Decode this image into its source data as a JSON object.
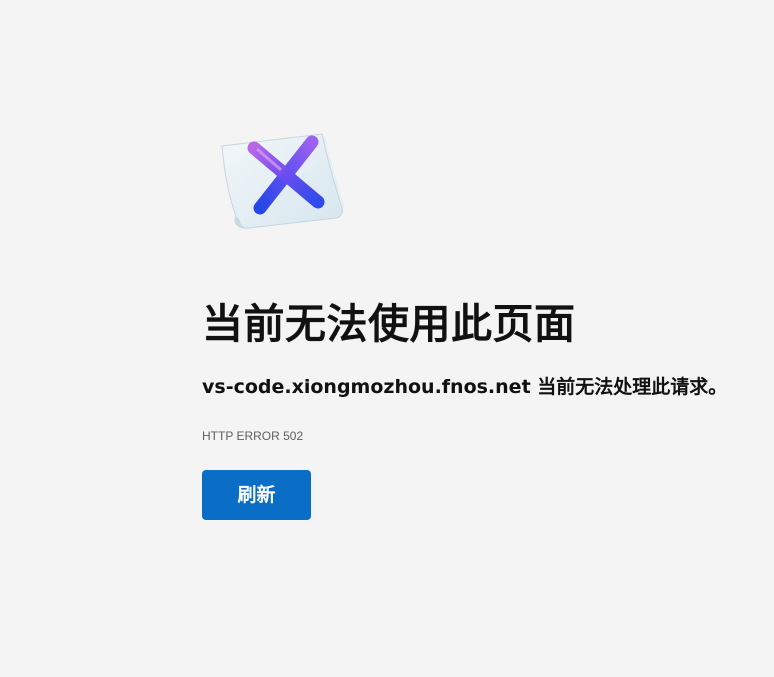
{
  "page": {
    "title": "当前无法使用此页面",
    "message": "vs-code.xiongmozhou.fnos.net 当前无法处理此请求。",
    "error_code": "HTTP ERROR 502",
    "refresh_label": "刷新"
  },
  "colors": {
    "background": "#f4f4f4",
    "button": "#0a6dc6",
    "button_text": "#ffffff",
    "error_code_text": "#5f5f5f"
  },
  "icons": {
    "illustration": "error-x-paper-icon"
  }
}
